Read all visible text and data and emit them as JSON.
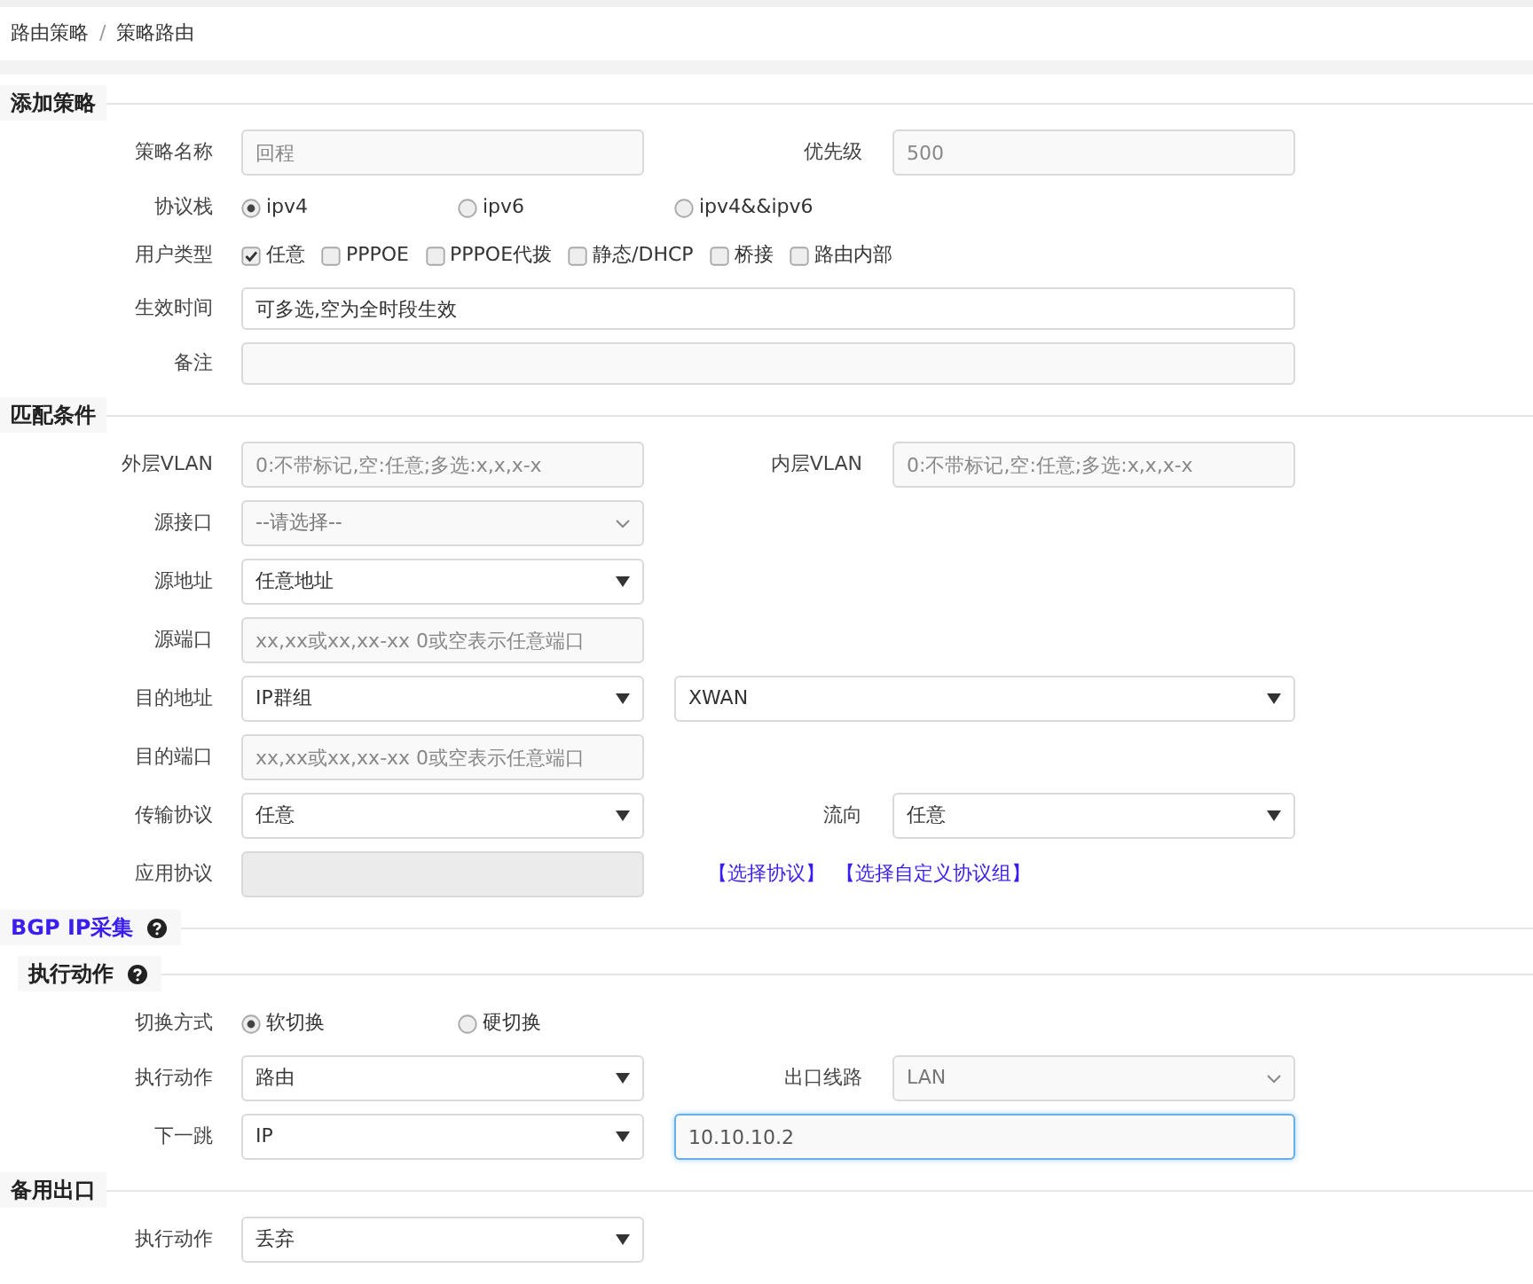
{
  "breadcrumb": {
    "items": [
      "路由策略",
      "策略路由"
    ],
    "separator": "/"
  },
  "sections": [
    {
      "title": "添加策略",
      "kind": "plain",
      "rows": [
        {
          "cells": [
            {
              "label": "策略名称",
              "control": {
                "kind": "input",
                "placeholder": "回程"
              }
            },
            {
              "label": "优先级",
              "control": {
                "kind": "input",
                "placeholder": "500"
              }
            }
          ]
        },
        {
          "cells": [
            {
              "label": "协议栈",
              "control": {
                "kind": "radios",
                "options": [
                  {
                    "text": "ipv4",
                    "selected": true
                  },
                  {
                    "text": "ipv6",
                    "selected": false
                  },
                  {
                    "text": "ipv4&&ipv6",
                    "selected": false
                  }
                ]
              }
            }
          ]
        },
        {
          "cells": [
            {
              "label": "用户类型",
              "control": {
                "kind": "checkboxes",
                "options": [
                  {
                    "text": "任意",
                    "checked": true
                  },
                  {
                    "text": "PPPOE",
                    "checked": false
                  },
                  {
                    "text": "PPPOE代拨",
                    "checked": false
                  },
                  {
                    "text": "静态/DHCP",
                    "checked": false
                  },
                  {
                    "text": "桥接",
                    "checked": false
                  },
                  {
                    "text": "路由内部",
                    "checked": false
                  }
                ]
              }
            }
          ]
        },
        {
          "cells": [
            {
              "label": "生效时间",
              "control": {
                "kind": "wide-input",
                "value": "可多选,空为全时段生效"
              }
            }
          ]
        },
        {
          "cells": [
            {
              "label": "备注",
              "control": {
                "kind": "wide-input"
              }
            }
          ]
        }
      ]
    },
    {
      "title": "匹配条件",
      "kind": "plain",
      "rows": [
        {
          "cells": [
            {
              "label": "外层VLAN",
              "control": {
                "kind": "input",
                "placeholder": "0:不带标记,空:任意;多选:x,x,x-x"
              }
            },
            {
              "label": "内层VLAN",
              "control": {
                "kind": "input",
                "placeholder": "0:不带标记,空:任意;多选:x,x,x-x"
              }
            }
          ]
        },
        {
          "cells": [
            {
              "label": "源接口",
              "control": {
                "kind": "native-select",
                "placeholder": "--请选择--"
              }
            }
          ]
        },
        {
          "cells": [
            {
              "label": "源地址",
              "control": {
                "kind": "select",
                "value": "任意地址"
              }
            }
          ]
        },
        {
          "cells": [
            {
              "label": "源端口",
              "control": {
                "kind": "input",
                "placeholder": "xx,xx或xx,xx-xx 0或空表示任意端口"
              }
            }
          ]
        },
        {
          "cells": [
            {
              "label": "目的地址",
              "control": {
                "kind": "select",
                "value": "IP群组"
              }
            },
            {
              "control": {
                "kind": "select",
                "value": "XWAN"
              }
            }
          ]
        },
        {
          "cells": [
            {
              "label": "目的端口",
              "control": {
                "kind": "input",
                "placeholder": "xx,xx或xx,xx-xx 0或空表示任意端口"
              }
            }
          ]
        },
        {
          "cells": [
            {
              "label": "传输协议",
              "control": {
                "kind": "select",
                "value": "任意"
              }
            },
            {
              "label": "流向",
              "control": {
                "kind": "select",
                "value": "任意"
              }
            }
          ]
        },
        {
          "cells": [
            {
              "label": "应用协议",
              "control": {
                "kind": "input",
                "disabled": true
              }
            },
            {
              "control": {
                "kind": "links",
                "items": [
                  "【选择协议】",
                  "【选择自定义协议组】"
                ]
              }
            }
          ]
        }
      ]
    },
    {
      "title": "BGP IP采集",
      "kind": "link",
      "help": true
    },
    {
      "title": "执行动作",
      "kind": "sub",
      "help": true,
      "rows": [
        {
          "cells": [
            {
              "label": "切换方式",
              "control": {
                "kind": "radios",
                "options": [
                  {
                    "text": "软切换",
                    "selected": true
                  },
                  {
                    "text": "硬切换",
                    "selected": false
                  }
                ]
              }
            }
          ]
        },
        {
          "cells": [
            {
              "label": "执行动作",
              "control": {
                "kind": "select",
                "value": "路由"
              }
            },
            {
              "label": "出口线路",
              "control": {
                "kind": "native-select",
                "value": "LAN",
                "disabled": true
              }
            }
          ]
        },
        {
          "cells": [
            {
              "label": "下一跳",
              "control": {
                "kind": "select",
                "value": "IP"
              }
            },
            {
              "control": {
                "kind": "input",
                "value": "10.10.10.2",
                "focused": true
              }
            }
          ]
        }
      ]
    },
    {
      "title": "备用出口",
      "kind": "plain",
      "rows": [
        {
          "cells": [
            {
              "label": "执行动作",
              "control": {
                "kind": "select",
                "value": "丢弃"
              }
            }
          ]
        }
      ]
    }
  ]
}
